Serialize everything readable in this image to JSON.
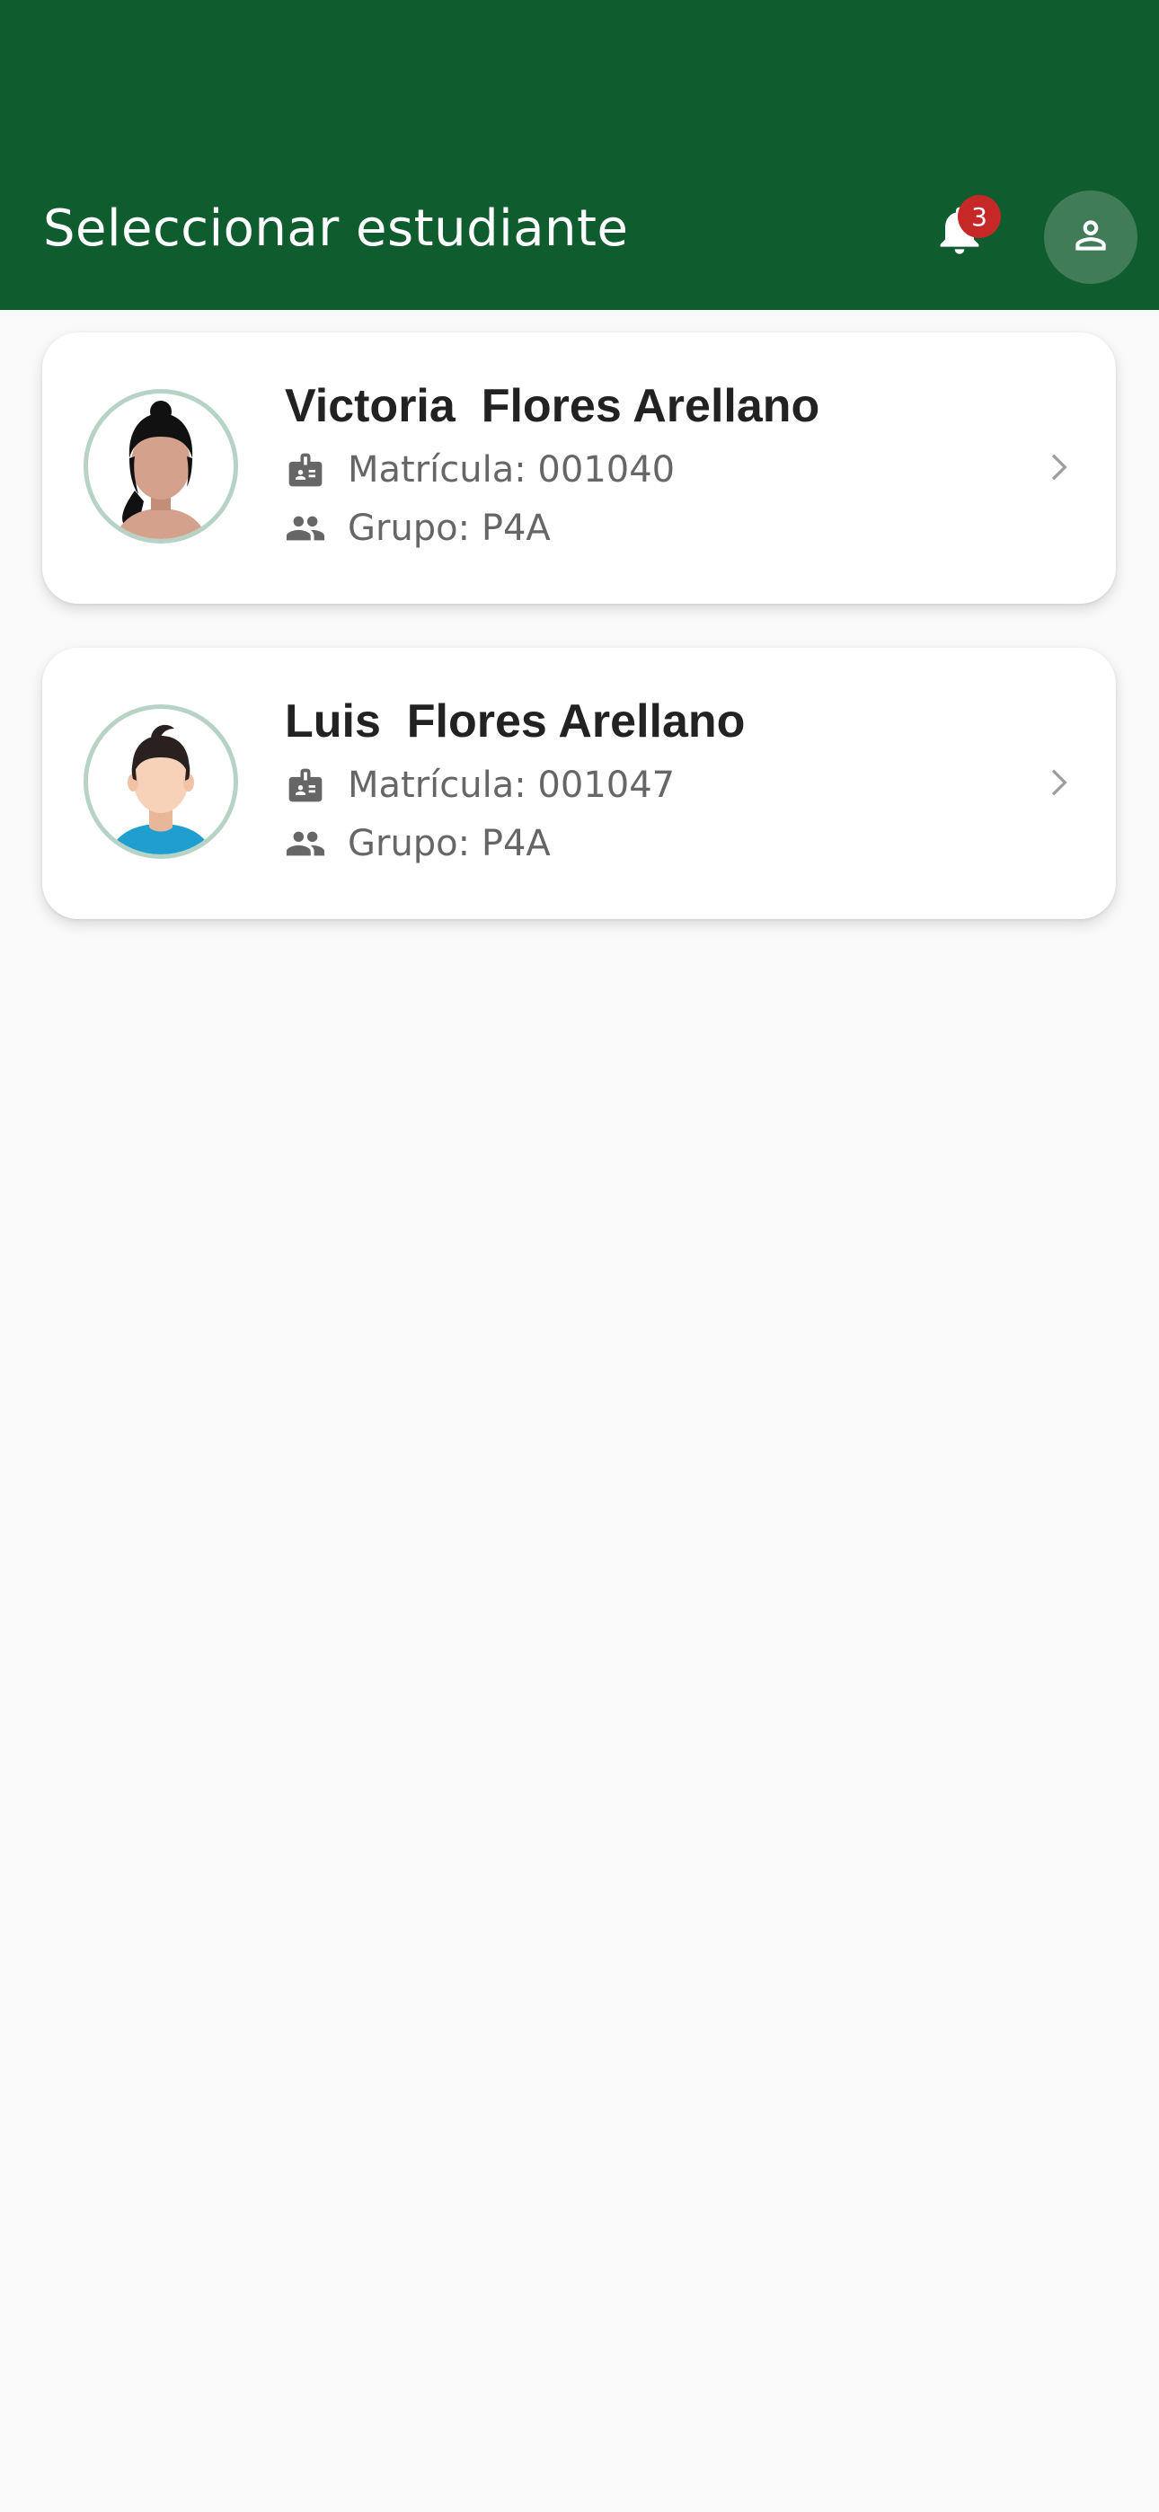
{
  "header": {
    "title": "Seleccionar estudiante",
    "notification_count": "3",
    "background_color": "#0f5c2e",
    "icons": {
      "notifications": "bell-icon",
      "profile": "person-icon"
    }
  },
  "students": [
    {
      "name": "Victoria  Flores Arellano",
      "id_text": "Matrícula: 001040",
      "group_text": "Grupo: P4A",
      "avatar": "female-avatar"
    },
    {
      "name": "Luis  Flores Arellano",
      "id_text": "Matrícula: 001047",
      "group_text": "Grupo: P4A",
      "avatar": "male-avatar"
    }
  ]
}
